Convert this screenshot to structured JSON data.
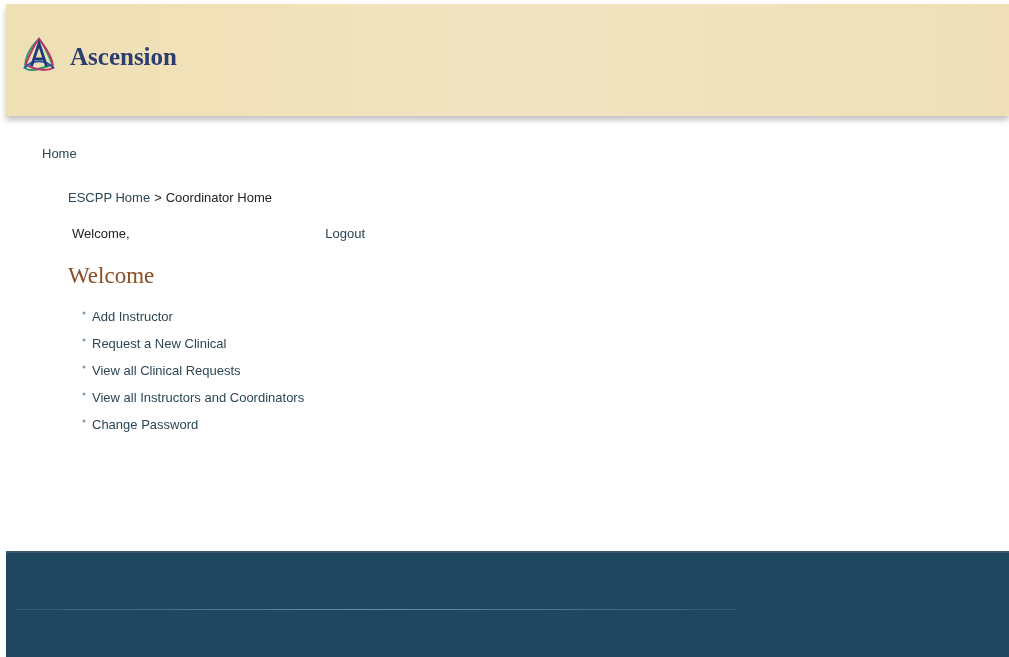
{
  "header": {
    "brand": "Ascension"
  },
  "nav": [
    "Home"
  ],
  "breadcrumb": {
    "items": [
      {
        "label": "ESCPP Home",
        "kind": "link"
      },
      {
        "label": "Coordinator Home",
        "kind": "current"
      }
    ],
    "separator": ">"
  },
  "user_bar": {
    "greeting": "Welcome,",
    "logout": "Logout"
  },
  "heading": "Welcome",
  "links": [
    "Add Instructor",
    "Request a New Clinical",
    "View all Clinical Requests",
    "View all Instructors and Coordinators",
    "Change Password"
  ]
}
